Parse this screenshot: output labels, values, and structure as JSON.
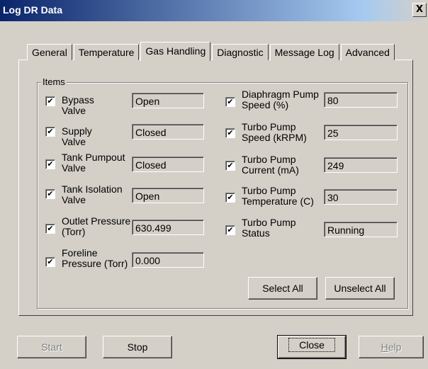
{
  "window": {
    "title": "Log DR Data",
    "close_label": "X"
  },
  "tabs": [
    {
      "label": "General",
      "active": false
    },
    {
      "label": "Temperature",
      "active": false
    },
    {
      "label": "Gas Handling",
      "active": true
    },
    {
      "label": "Diagnostic",
      "active": false
    },
    {
      "label": "Message Log",
      "active": false
    },
    {
      "label": "Advanced",
      "active": false
    }
  ],
  "items_group": {
    "title": "Items",
    "left": [
      {
        "label": "Bypass Valve",
        "value": "Open",
        "checked": true
      },
      {
        "label": "Supply Valve",
        "value": "Closed",
        "checked": true
      },
      {
        "label": "Tank Pumpout Valve",
        "value": "Closed",
        "checked": true
      },
      {
        "label": "Tank Isolation Valve",
        "value": "Open",
        "checked": true
      },
      {
        "label": "Outlet Pressure (Torr)",
        "value": "630.499",
        "checked": true
      },
      {
        "label": "Foreline Pressure (Torr)",
        "value": "0.000",
        "checked": true
      }
    ],
    "right": [
      {
        "label": "Diaphragm Pump Speed (%)",
        "value": "80",
        "checked": true
      },
      {
        "label": "Turbo Pump Speed (kRPM)",
        "value": "25",
        "checked": true
      },
      {
        "label": "Turbo Pump Current (mA)",
        "value": "249",
        "checked": true
      },
      {
        "label": "Turbo Pump Temperature (C)",
        "value": "30",
        "checked": true
      },
      {
        "label": "Turbo Pump Status",
        "value": "Running",
        "checked": true
      }
    ],
    "select_all_label": "Select All",
    "unselect_all_label": "Unselect All",
    "check_glyph": "✔"
  },
  "footer": {
    "start_label": "Start",
    "stop_label": "Stop",
    "close_label": "Close",
    "help_first": "H",
    "help_rest": "elp"
  }
}
